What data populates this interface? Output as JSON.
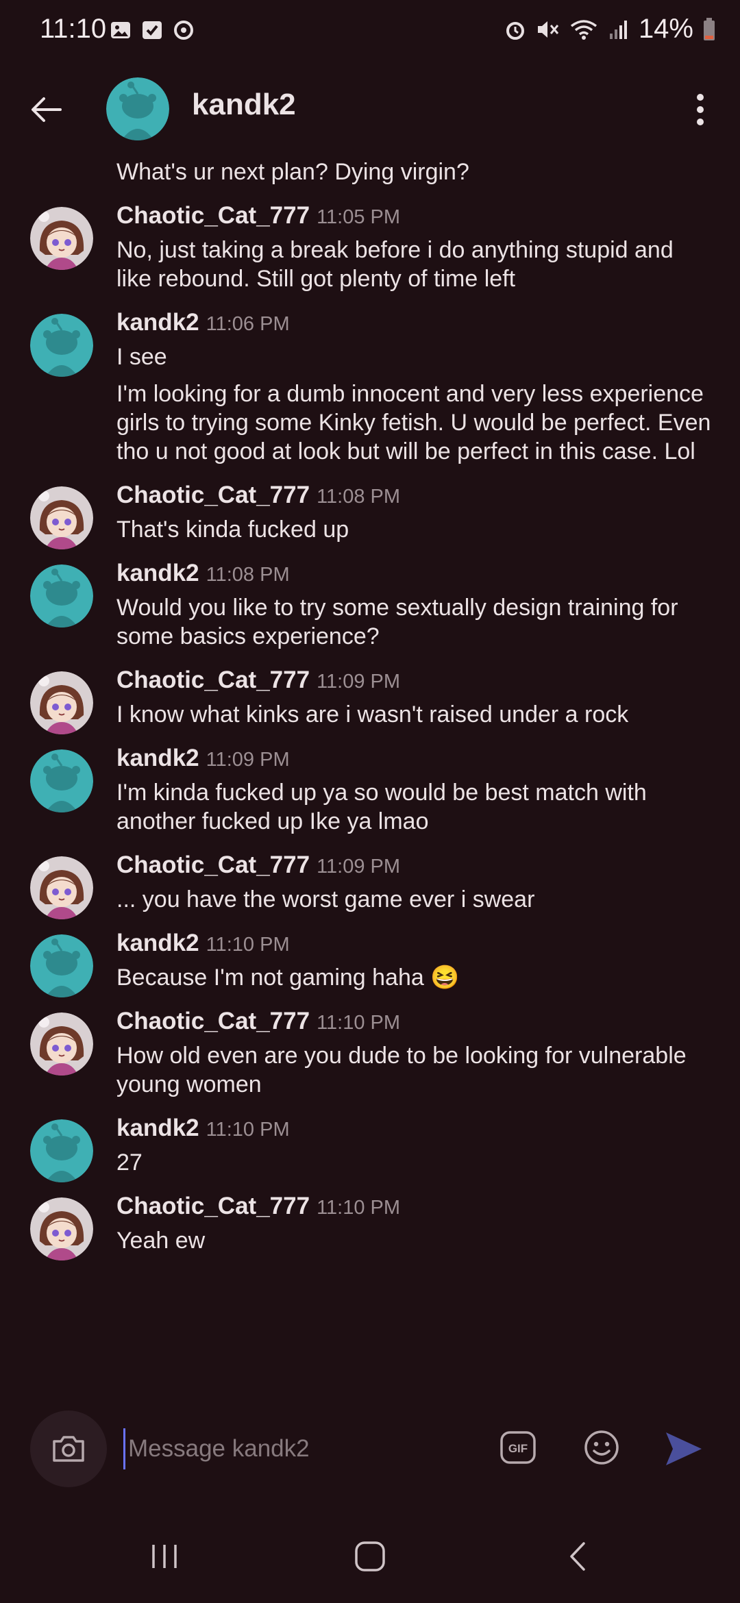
{
  "status_bar": {
    "time": "11:10",
    "battery": "14%"
  },
  "header": {
    "title": "kandk2"
  },
  "messages": [
    {
      "type": "continuation",
      "text": "What's ur next plan?  Dying virgin?"
    },
    {
      "type": "group",
      "user": "Chaotic_Cat_777",
      "avatar": "cat",
      "time": "11:05 PM",
      "texts": [
        "No, just taking a break before i do anything stupid and like rebound. Still got plenty of time left"
      ]
    },
    {
      "type": "group",
      "user": "kandk2",
      "avatar": "snoo",
      "time": "11:06 PM",
      "texts": [
        "I see",
        "I'm looking for a dumb innocent and very less experience girls to trying some Kinky fetish. U would be perfect. Even tho u not good at look but will be perfect in this case.  Lol"
      ]
    },
    {
      "type": "group",
      "user": "Chaotic_Cat_777",
      "avatar": "cat",
      "time": "11:08 PM",
      "texts": [
        "That's kinda fucked up"
      ]
    },
    {
      "type": "group",
      "user": "kandk2",
      "avatar": "snoo",
      "time": "11:08 PM",
      "texts": [
        "Would you like to try some sextually design training for some basics experience?"
      ]
    },
    {
      "type": "group",
      "user": "Chaotic_Cat_777",
      "avatar": "cat",
      "time": "11:09 PM",
      "texts": [
        "I know what kinks are i wasn't raised under a rock"
      ]
    },
    {
      "type": "group",
      "user": "kandk2",
      "avatar": "snoo",
      "time": "11:09 PM",
      "texts": [
        "I'm kinda fucked up ya so would be best match with another fucked up Ike ya lmao"
      ]
    },
    {
      "type": "group",
      "user": "Chaotic_Cat_777",
      "avatar": "cat",
      "time": "11:09 PM",
      "texts": [
        "... you have the worst game ever i swear"
      ]
    },
    {
      "type": "group",
      "user": "kandk2",
      "avatar": "snoo",
      "time": "11:10 PM",
      "texts": [
        "Because I'm not gaming haha 😆"
      ]
    },
    {
      "type": "group",
      "user": "Chaotic_Cat_777",
      "avatar": "cat",
      "time": "11:10 PM",
      "texts": [
        "How old even are you dude to be looking for vulnerable young women"
      ]
    },
    {
      "type": "group",
      "user": "kandk2",
      "avatar": "snoo",
      "time": "11:10 PM",
      "texts": [
        "27"
      ]
    },
    {
      "type": "group",
      "user": "Chaotic_Cat_777",
      "avatar": "cat",
      "time": "11:10 PM",
      "texts": [
        "Yeah ew"
      ]
    }
  ],
  "composer": {
    "placeholder": "Message kandk2",
    "value": ""
  },
  "icons": {
    "back": "arrow-left-icon",
    "more": "kebab-menu-icon",
    "camera": "camera-icon",
    "gif": "gif-icon",
    "emoji": "emoji-icon",
    "send": "send-icon"
  },
  "colors": {
    "background": "#1e0f13",
    "text": "#ece3e5",
    "muted": "#9c8f93",
    "snoo_teal": "#3fb0b4",
    "send_accent": "#4a4f9c"
  }
}
